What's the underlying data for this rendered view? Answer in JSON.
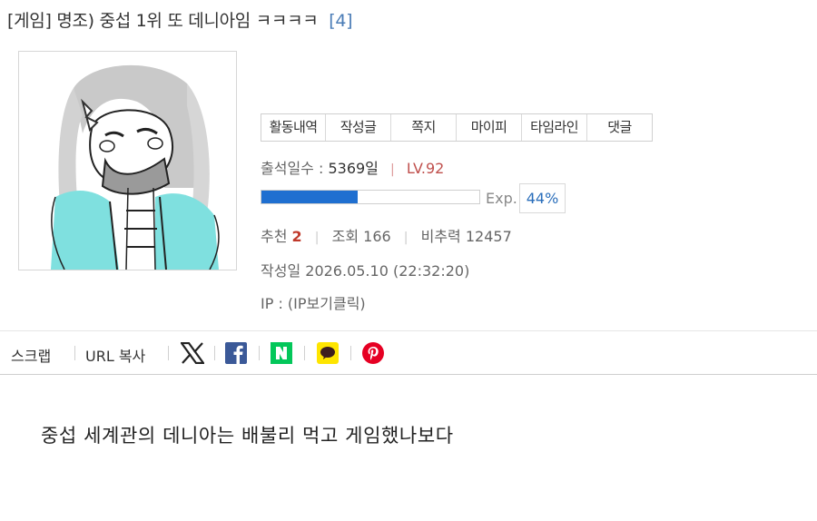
{
  "post": {
    "title": "[게임] 명조) 중섭 1위 또 데니아임 ㅋㅋㅋㅋ",
    "comment_count": "[4]",
    "body": "중섭 세계관의 데니아는 배불리 먹고 게임했나보다"
  },
  "profile_menu": [
    "활동내역",
    "작성글",
    "쪽지",
    "마이피",
    "타임라인",
    "댓글"
  ],
  "author": {
    "attendance_label": "출석일수 :",
    "attendance_value": "5369일",
    "level": "LV.92",
    "exp_label": "Exp.",
    "exp_percent": "44%",
    "exp_fraction": 0.44
  },
  "stats": {
    "recommend_label": "추천",
    "recommend_value": "2",
    "views_label": "조회",
    "views_value": "166",
    "nonrec_label": "비추력",
    "nonrec_value": "12457"
  },
  "written": {
    "label": "작성일",
    "value": "2026.05.10 (22:32:20)"
  },
  "ip": {
    "text": "IP : (IP보기클릭)"
  },
  "share": {
    "scrap_label": "스크랩",
    "url_copy_label": "URL 복사",
    "icons": [
      "x-icon",
      "facebook-icon",
      "naver-icon",
      "kakaotalk-icon",
      "pinterest-icon"
    ]
  },
  "colors": {
    "accent_blue": "#1f6fd0",
    "level_red": "#c0504d",
    "link_blue": "#4a7cb6",
    "facebook": "#3b5998",
    "naver": "#03c75a",
    "kakao": "#fee500",
    "pinterest": "#e60023"
  }
}
